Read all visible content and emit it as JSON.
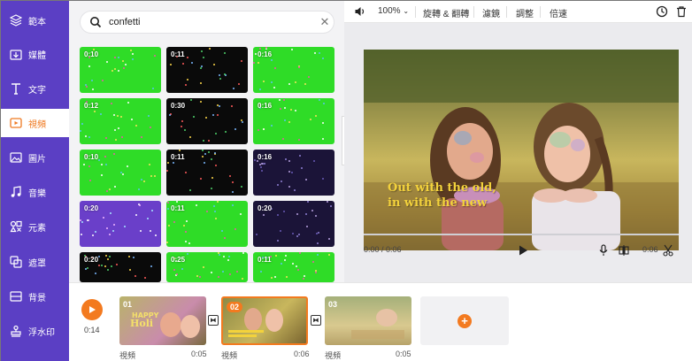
{
  "sidebar": {
    "items": [
      {
        "label": "範本",
        "icon": "layers-icon"
      },
      {
        "label": "媒體",
        "icon": "upload-folder-icon"
      },
      {
        "label": "文字",
        "icon": "text-icon"
      },
      {
        "label": "視頻",
        "icon": "video-icon",
        "active": true
      },
      {
        "label": "圖片",
        "icon": "image-icon"
      },
      {
        "label": "音樂",
        "icon": "music-icon"
      },
      {
        "label": "元素",
        "icon": "elements-icon"
      },
      {
        "label": "遮罩",
        "icon": "overlay-icon"
      },
      {
        "label": "背景",
        "icon": "background-icon"
      },
      {
        "label": "浮水印",
        "icon": "watermark-icon"
      }
    ]
  },
  "search": {
    "value": "confetti"
  },
  "results": [
    {
      "duration": "0:10",
      "bg": "g"
    },
    {
      "duration": "0:11",
      "bg": "k"
    },
    {
      "duration": "0:16",
      "bg": "g"
    },
    {
      "duration": "0:12",
      "bg": "g"
    },
    {
      "duration": "0:30",
      "bg": "k"
    },
    {
      "duration": "0:16",
      "bg": "g"
    },
    {
      "duration": "0:10",
      "bg": "g"
    },
    {
      "duration": "0:11",
      "bg": "k"
    },
    {
      "duration": "0:16",
      "bg": "n"
    },
    {
      "duration": "0:20",
      "bg": "p"
    },
    {
      "duration": "0:11",
      "bg": "g"
    },
    {
      "duration": "0:20",
      "bg": "n"
    },
    {
      "duration": "0:20",
      "bg": "k"
    },
    {
      "duration": "0:25",
      "bg": "g"
    },
    {
      "duration": "0:11",
      "bg": "g"
    }
  ],
  "toolbar": {
    "zoom": "100%",
    "rotate": "旋轉 & 翻轉",
    "filter": "濾鏡",
    "adjust": "調整",
    "speed": "倍速"
  },
  "preview": {
    "caption_line1": "Out with the old,",
    "caption_line2": "in with the new",
    "current_time": "0:00 / 0:06",
    "end_time": "0:06"
  },
  "timeline": {
    "total_time": "0:14",
    "clips": [
      {
        "num": "01",
        "label": "視頻",
        "duration": "0:05"
      },
      {
        "num": "02",
        "label": "視頻",
        "duration": "0:06",
        "selected": true
      },
      {
        "num": "03",
        "label": "視頻",
        "duration": "0:05"
      }
    ]
  }
}
